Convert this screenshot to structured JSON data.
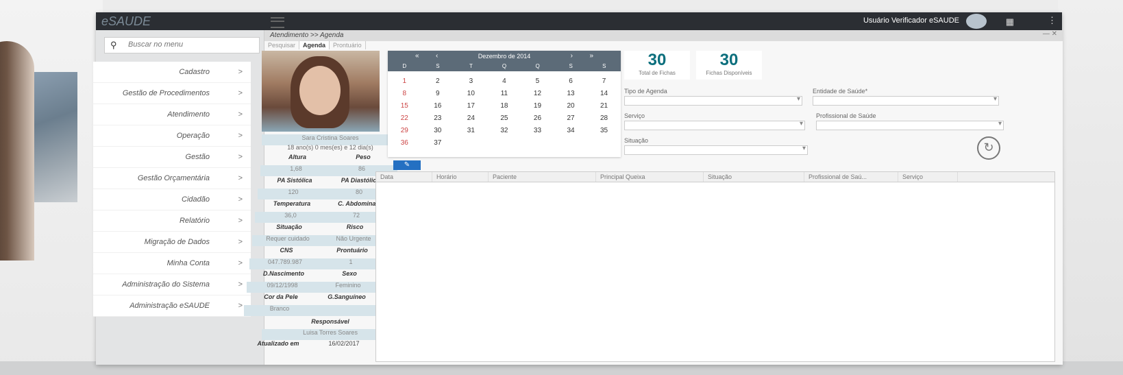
{
  "app": {
    "brand": "eSAUDE",
    "user": "Usuário Verificador eSAUDE"
  },
  "search": {
    "placeholder": "Buscar no menu"
  },
  "menu": [
    {
      "label": "Cadastro"
    },
    {
      "label": "Gestão de Procedimentos"
    },
    {
      "label": "Atendimento"
    },
    {
      "label": "Operação"
    },
    {
      "label": "Gestão"
    },
    {
      "label": "Gestão Orçamentária"
    },
    {
      "label": "Cidadão"
    },
    {
      "label": "Relatório"
    },
    {
      "label": "Migração de Dados"
    },
    {
      "label": "Minha Conta"
    },
    {
      "label": "Administração do Sistema"
    },
    {
      "label": "Administração eSAUDE"
    }
  ],
  "window": {
    "title": "Atendimento >> Agenda",
    "tabs": [
      "Pesquisar",
      "Agenda",
      "Prontuário"
    ]
  },
  "patient": {
    "name": "Sara Cristina Soares",
    "age": "18 ano(s) 0 mes(es) e 12 dia(s)",
    "rows": [
      [
        "Altura",
        "Peso"
      ],
      [
        "1,68",
        "86"
      ],
      [
        "PA Sistólica",
        "PA Diastólica"
      ],
      [
        "120",
        "80"
      ],
      [
        "Temperatura",
        "C. Abdominal"
      ],
      [
        "36,0",
        "72"
      ],
      [
        "Situação",
        "Risco"
      ],
      [
        "Requer cuidado",
        "Não Urgente"
      ],
      [
        "CNS",
        "Prontuário"
      ],
      [
        "047.789.987",
        "1"
      ],
      [
        "D.Nascimento",
        "Sexo"
      ],
      [
        "09/12/1998",
        "Feminino"
      ],
      [
        "Cor da Pele",
        "G.Sanguíneo"
      ],
      [
        "Branco",
        ""
      ]
    ],
    "responsavel_label": "Responsável",
    "responsavel": "Luisa Torres Soares",
    "updated_label": "Atualizado em",
    "updated": "16/02/2017"
  },
  "calendar": {
    "month": "Dezembro de 2014",
    "dow": [
      "D",
      "S",
      "T",
      "Q",
      "Q",
      "S",
      "S"
    ],
    "days": [
      "1",
      "2",
      "3",
      "4",
      "5",
      "6",
      "7",
      "8",
      "9",
      "10",
      "11",
      "12",
      "13",
      "14",
      "15",
      "16",
      "17",
      "18",
      "19",
      "20",
      "21",
      "22",
      "23",
      "24",
      "25",
      "26",
      "27",
      "28",
      "29",
      "30",
      "31",
      "32",
      "33",
      "34",
      "35",
      "36",
      "37"
    ]
  },
  "counters": {
    "total": {
      "value": "30",
      "label": "Total de Fichas"
    },
    "available": {
      "value": "30",
      "label": "Fichas Disponíveis"
    }
  },
  "form": {
    "tipo_agenda": "Tipo de Agenda",
    "entidade": "Entidade de Saúde*",
    "servico": "Serviço",
    "profissional": "Profissional de Saúde",
    "situacao": "Situação"
  },
  "table": {
    "columns": [
      "Data",
      "Horário",
      "Paciente",
      "Principal Queixa",
      "Situação",
      "Profissional de Saú...",
      "Serviço"
    ]
  },
  "colors": {
    "accent": "#0c6f7d",
    "topbar": "#2b2e33",
    "button": "#2470c2"
  }
}
